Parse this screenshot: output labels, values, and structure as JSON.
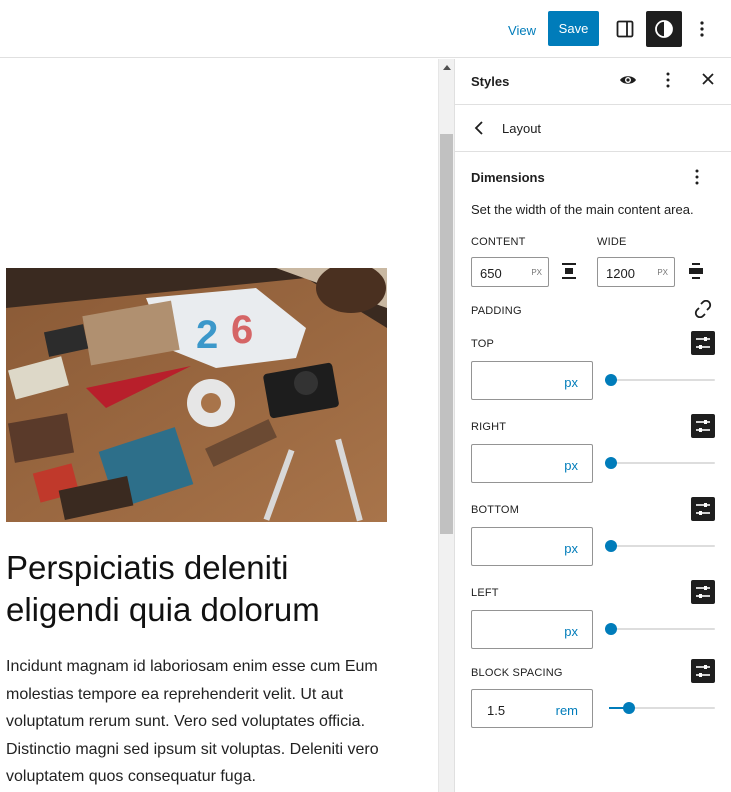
{
  "header": {
    "view_label": "View",
    "save_label": "Save",
    "accent_color": "#007cba"
  },
  "canvas": {
    "image_alt": "Flat lay of vintage items on a wooden table",
    "title": "Perspiciatis deleniti eligendi quia dolorum",
    "body": "Incidunt magnam id laboriosam enim esse cum Eum molestias tempore ea reprehenderit velit. Ut aut voluptatum rerum sunt. Vero sed voluptates officia. Distinctio magni sed ipsum sit voluptas. Deleniti vero voluptatem quos consequatur fuga."
  },
  "sidebar": {
    "title": "Styles",
    "nav_label": "Layout",
    "panel": {
      "title": "Dimensions",
      "help": "Set the width of the main content area.",
      "content_label": "CONTENT",
      "content_value": "650",
      "content_unit": "PX",
      "wide_label": "WIDE",
      "wide_value": "1200",
      "wide_unit": "PX",
      "padding_label": "PADDING",
      "sides": [
        {
          "label": "TOP",
          "value": "",
          "unit": "px",
          "slider_fraction": 0
        },
        {
          "label": "RIGHT",
          "value": "",
          "unit": "px",
          "slider_fraction": 0
        },
        {
          "label": "BOTTOM",
          "value": "",
          "unit": "px",
          "slider_fraction": 0
        },
        {
          "label": "LEFT",
          "value": "",
          "unit": "px",
          "slider_fraction": 0
        }
      ],
      "block_spacing": {
        "label": "BLOCK SPACING",
        "value": "1.5",
        "unit": "rem",
        "slider_fraction": 0.15
      }
    }
  }
}
